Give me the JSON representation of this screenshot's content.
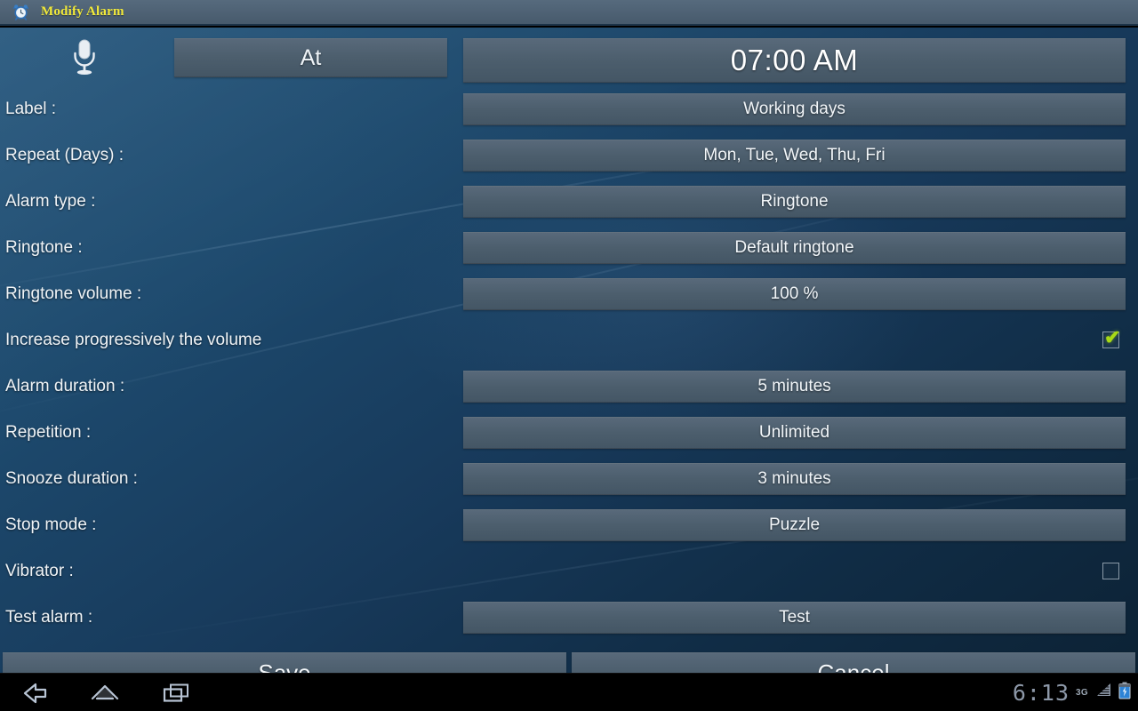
{
  "titlebar": {
    "icon": "alarm-clock-icon",
    "title": "Modify Alarm",
    "title_color": "#f2ea3a"
  },
  "header": {
    "mic_icon": "microphone-icon",
    "mode_label": "At",
    "time": "07:00 AM"
  },
  "rows": [
    {
      "label": "Label :",
      "value": "Working days",
      "type": "field"
    },
    {
      "label": "Repeat (Days) :",
      "value": "Mon, Tue, Wed, Thu, Fri",
      "type": "field"
    },
    {
      "label": "Alarm type :",
      "value": "Ringtone",
      "type": "field"
    },
    {
      "label": "Ringtone :",
      "value": "Default ringtone",
      "type": "field"
    },
    {
      "label": "Ringtone volume :",
      "value": "100 %",
      "type": "field"
    },
    {
      "label": "Increase progressively the volume",
      "value": "",
      "type": "checkbox",
      "checked": true
    },
    {
      "label": "Alarm duration :",
      "value": "5 minutes",
      "type": "field"
    },
    {
      "label": "Repetition :",
      "value": "Unlimited",
      "type": "field"
    },
    {
      "label": "Snooze duration :",
      "value": "3 minutes",
      "type": "field"
    },
    {
      "label": "Stop mode :",
      "value": "Puzzle",
      "type": "field"
    },
    {
      "label": "Vibrator :",
      "value": "",
      "type": "checkbox",
      "checked": false
    },
    {
      "label": "Test alarm :",
      "value": "Test",
      "type": "field"
    }
  ],
  "buttons": {
    "save": "Save",
    "cancel": "Cancel"
  },
  "navbar": {
    "back_icon": "back-arrow-icon",
    "home_icon": "home-icon",
    "recent_icon": "recent-apps-icon"
  },
  "statusbar": {
    "clock": "6:13",
    "network": "3G",
    "signal_icon": "signal-bars-icon",
    "battery_icon": "battery-charging-icon"
  },
  "colors": {
    "accent_check": "#a8d916",
    "title_text": "#f2ea3a",
    "field_bg": "#4c5e6d",
    "background_top": "#27587e",
    "background_bottom": "#0c2235"
  }
}
